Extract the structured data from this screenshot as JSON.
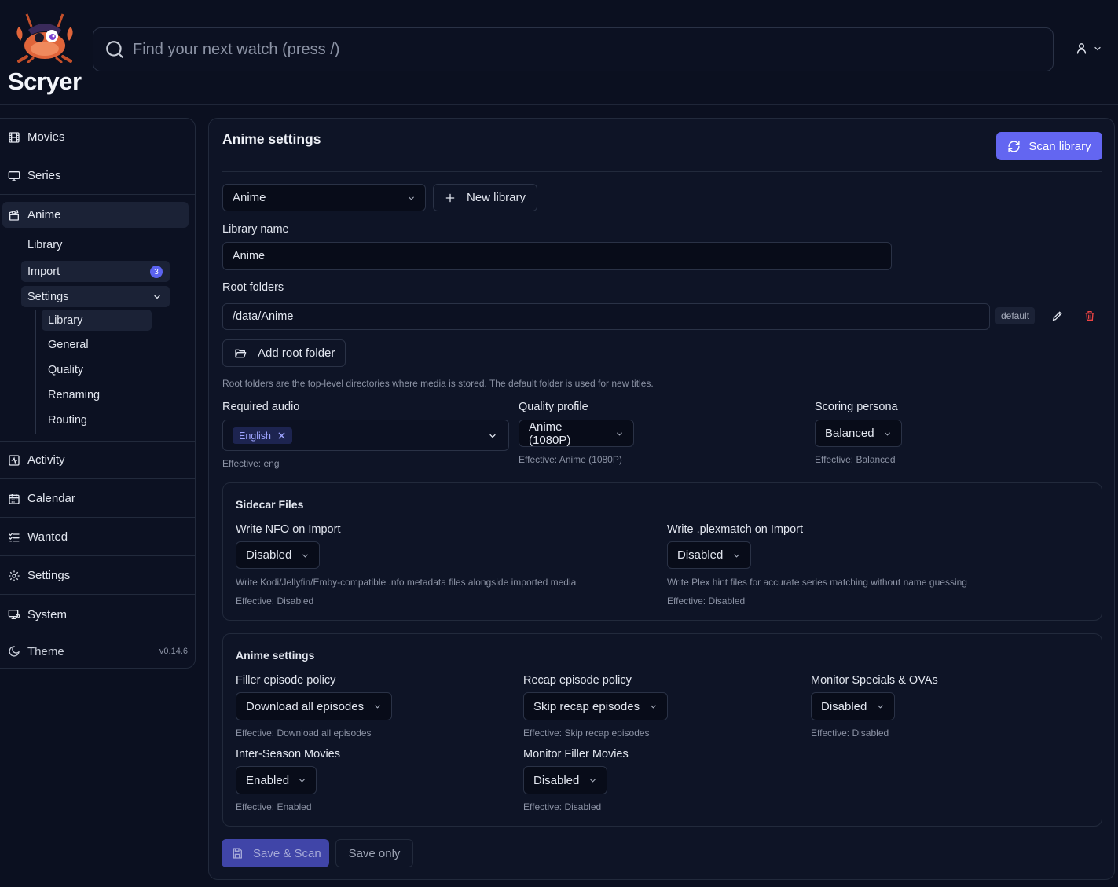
{
  "app": {
    "name": "Scryer",
    "version": "v0.14.6"
  },
  "search": {
    "placeholder": "Find your next watch (press /)"
  },
  "sidebar": {
    "items": [
      {
        "label": "Movies",
        "icon": "film-icon"
      },
      {
        "label": "Series",
        "icon": "monitor-icon"
      },
      {
        "label": "Anime",
        "icon": "clapperboard-icon"
      },
      {
        "label": "Activity",
        "icon": "activity-icon"
      },
      {
        "label": "Calendar",
        "icon": "calendar-icon"
      },
      {
        "label": "Wanted",
        "icon": "list-checks-icon"
      },
      {
        "label": "Settings",
        "icon": "gear-icon"
      },
      {
        "label": "System",
        "icon": "system-icon"
      }
    ],
    "anime_sub": {
      "library": "Library",
      "import": "Import",
      "import_count": "3",
      "settings": "Settings",
      "settings_sub": [
        "Library",
        "General",
        "Quality",
        "Renaming",
        "Routing"
      ]
    },
    "theme": "Theme"
  },
  "main": {
    "title": "Anime settings",
    "scan_button": "Scan library",
    "library_select": "Anime",
    "new_library": "New library",
    "library_name_label": "Library name",
    "library_name_value": "Anime",
    "root_folders_label": "Root folders",
    "root_folder_path": "/data/Anime",
    "default_tag": "default",
    "add_root_folder": "Add root folder",
    "root_hint": "Root folders are the top-level directories where media is stored. The default folder is used for new titles.",
    "required_audio_label": "Required audio",
    "required_audio_chip": "English",
    "required_audio_effective": "Effective: eng",
    "quality_profile_label": "Quality profile",
    "quality_profile_value": "Anime (1080P)",
    "quality_profile_effective": "Effective: Anime (1080P)",
    "scoring_persona_label": "Scoring persona",
    "scoring_persona_value": "Balanced",
    "scoring_persona_effective": "Effective: Balanced"
  },
  "sidecar": {
    "title": "Sidecar Files",
    "nfo_label": "Write NFO on Import",
    "nfo_value": "Disabled",
    "nfo_hint": "Write Kodi/Jellyfin/Emby-compatible .nfo metadata files alongside imported media",
    "nfo_effective": "Effective: Disabled",
    "plex_label": "Write .plexmatch on Import",
    "plex_value": "Disabled",
    "plex_hint": "Write Plex hint files for accurate series matching without name guessing",
    "plex_effective": "Effective: Disabled"
  },
  "anime_settings": {
    "title": "Anime settings",
    "filler_label": "Filler episode policy",
    "filler_value": "Download all episodes",
    "filler_effective": "Effective: Download all episodes",
    "recap_label": "Recap episode policy",
    "recap_value": "Skip recap episodes",
    "recap_effective": "Effective: Skip recap episodes",
    "specials_label": "Monitor Specials & OVAs",
    "specials_value": "Disabled",
    "specials_effective": "Effective: Disabled",
    "interseason_label": "Inter-Season Movies",
    "interseason_value": "Enabled",
    "interseason_effective": "Effective: Enabled",
    "filler_movies_label": "Monitor Filler Movies",
    "filler_movies_value": "Disabled",
    "filler_movies_effective": "Effective: Disabled"
  },
  "footer": {
    "save_scan": "Save & Scan",
    "save_only": "Save only"
  },
  "colors": {
    "background": "#0b1020",
    "accent": "#6366f1",
    "danger": "#ef4444"
  }
}
